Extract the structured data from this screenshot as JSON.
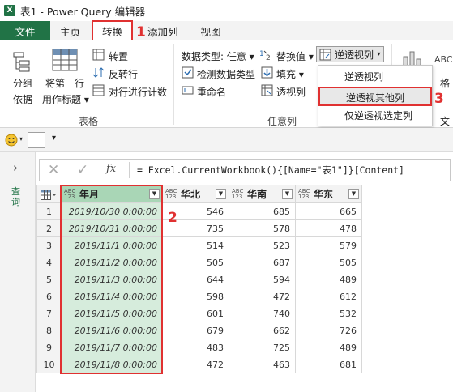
{
  "window": {
    "title": "表1 - Power Query 编辑器",
    "app_icon": "X"
  },
  "tabs": [
    {
      "label": "文件"
    },
    {
      "label": "主页"
    },
    {
      "label": "转换"
    },
    {
      "label": "添加列"
    },
    {
      "label": "视图"
    }
  ],
  "ribbon": {
    "group_btn": {
      "line1": "分组",
      "line2": "依据"
    },
    "first_row_btn": {
      "line1": "将第一行",
      "line2": "用作标题"
    },
    "transpose": "转置",
    "reverse_rows": "反转行",
    "count_rows": "对行进行计数",
    "table_group": "表格",
    "data_type": "数据类型: 任意",
    "detect_type": "检测数据类型",
    "rename": "重命名",
    "replace_values": "替换值",
    "fill": "填充",
    "pivot": "透视列",
    "unpivot": "逆透视列",
    "any_column_group": "任意列",
    "right_format_short": "格",
    "right_text_short": "文"
  },
  "unpivot_menu": {
    "items": [
      "逆透视列",
      "逆透视其他列",
      "仅逆透视选定列"
    ]
  },
  "quick_access": {
    "dropdown_symbol": "▾"
  },
  "sidebar": {
    "label": "查询"
  },
  "formula_bar": {
    "fx": "fx",
    "formula": "= Excel.CurrentWorkbook(){[Name=\"表1\"]}[Content]"
  },
  "table": {
    "type_badge": "ABC\n123",
    "columns": [
      "年月",
      "华北",
      "华南",
      "华东"
    ],
    "rows": [
      {
        "n": "1",
        "date": "2019/10/30 0:00:00",
        "north": "546",
        "south": "685",
        "east": "665"
      },
      {
        "n": "2",
        "date": "2019/10/31 0:00:00",
        "north": "735",
        "south": "578",
        "east": "478"
      },
      {
        "n": "3",
        "date": "2019/11/1 0:00:00",
        "north": "514",
        "south": "523",
        "east": "579"
      },
      {
        "n": "4",
        "date": "2019/11/2 0:00:00",
        "north": "505",
        "south": "687",
        "east": "505"
      },
      {
        "n": "5",
        "date": "2019/11/3 0:00:00",
        "north": "644",
        "south": "594",
        "east": "489"
      },
      {
        "n": "6",
        "date": "2019/11/4 0:00:00",
        "north": "598",
        "south": "472",
        "east": "612"
      },
      {
        "n": "7",
        "date": "2019/11/5 0:00:00",
        "north": "601",
        "south": "740",
        "east": "532"
      },
      {
        "n": "8",
        "date": "2019/11/6 0:00:00",
        "north": "679",
        "south": "662",
        "east": "726"
      },
      {
        "n": "9",
        "date": "2019/11/7 0:00:00",
        "north": "483",
        "south": "725",
        "east": "489"
      },
      {
        "n": "10",
        "date": "2019/11/8 0:00:00",
        "north": "472",
        "south": "463",
        "east": "681"
      }
    ]
  },
  "annotations": {
    "marker1": "1",
    "marker2": "2",
    "marker3": "3",
    "highlight_color": "#e03131"
  },
  "colors": {
    "excel_green": "#217346",
    "selected_column": "#d6ecdc",
    "selected_header": "#a9d6b6"
  }
}
